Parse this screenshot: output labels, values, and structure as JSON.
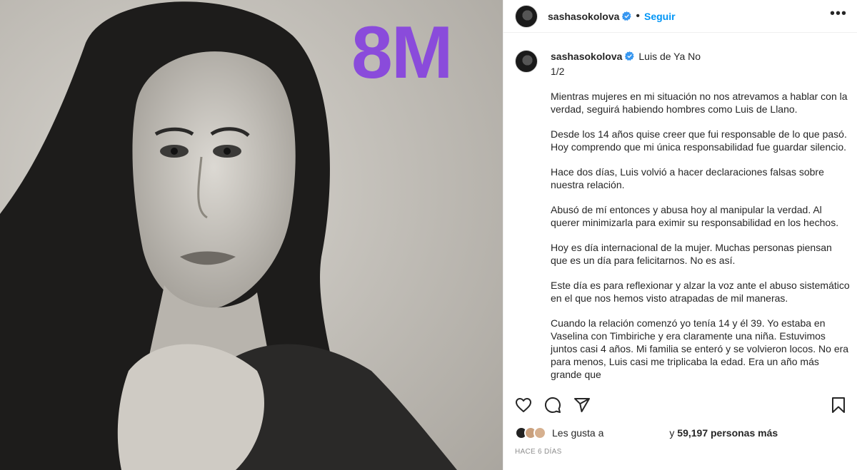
{
  "post": {
    "image_badge": "8M",
    "header": {
      "username": "sashasokolova",
      "separator": "•",
      "follow_label": "Seguir",
      "more_label": "•••"
    },
    "caption": {
      "username": "sashasokolova",
      "title": "Luis de Ya No",
      "page": "1/2",
      "paragraphs": [
        "Mientras mujeres en mi situación no nos atrevamos a hablar con la verdad, seguirá habiendo hombres como Luis de Llano.",
        "Desde los 14 años quise creer que fui responsable de lo que pasó. Hoy comprendo que mi única responsabilidad fue guardar silencio.",
        "Hace dos días, Luis volvió a hacer declaraciones falsas sobre nuestra relación.",
        "Abusó de mí entonces y abusa hoy al manipular la verdad. Al querer minimizarla para eximir su responsabilidad en los hechos.",
        "Hoy es día internacional de la mujer. Muchas personas piensan que es un día para felicitarnos. No es así.",
        "Este día es para reflexionar y alzar la voz ante el abuso sistemático en el que nos hemos visto atrapadas de mil maneras.",
        "Cuando la relación comenzó yo tenía 14 y él 39. Yo estaba en Vaselina con Timbiriche y era claramente una niña. Estuvimos juntos casi 4 años. Mi familia se enteró y se volvieron locos. No era para menos, Luis casi me triplicaba la edad. Era un año más grande que"
      ]
    },
    "actions": {
      "like_icon": "heart-icon",
      "comment_icon": "comment-icon",
      "share_icon": "share-icon",
      "save_icon": "bookmark-icon"
    },
    "likes": {
      "label": "Les gusta a",
      "tail_prefix": "y",
      "count_text": "59,197 personas más"
    },
    "date": "HACE 6 DÍAS",
    "colors": {
      "accent_badge": "#8a4bdb",
      "follow_blue": "#0095f6",
      "verified_blue": "#3897f0"
    }
  }
}
